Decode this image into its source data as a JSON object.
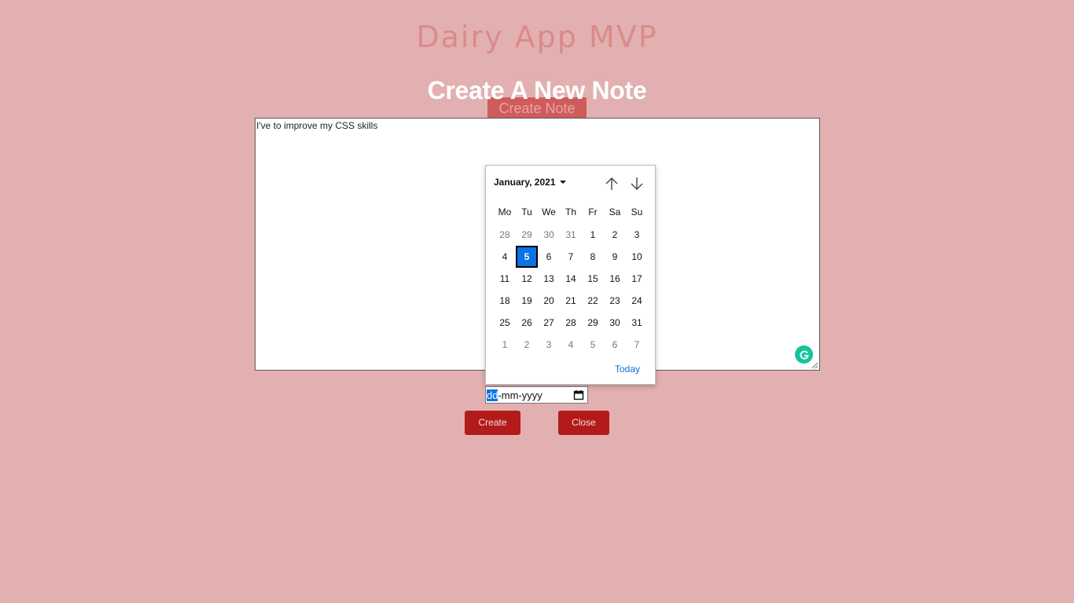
{
  "app": {
    "title": "Dairy App MVP",
    "create_note_label": "Create Note"
  },
  "modal": {
    "title": "Create A New Note",
    "note_text": "I've to improve my CSS skills",
    "date_input": {
      "day_placeholder": "dd",
      "rest_placeholder": "-mm-yyyy"
    },
    "create_label": "Create",
    "close_label": "Close"
  },
  "calendar": {
    "month_label": "January, 2021",
    "weekdays": [
      "Mo",
      "Tu",
      "We",
      "Th",
      "Fr",
      "Sa",
      "Su"
    ],
    "weeks": [
      [
        "28",
        "29",
        "30",
        "31",
        "1",
        "2",
        "3"
      ],
      [
        "4",
        "5",
        "6",
        "7",
        "8",
        "9",
        "10"
      ],
      [
        "11",
        "12",
        "13",
        "14",
        "15",
        "16",
        "17"
      ],
      [
        "18",
        "19",
        "20",
        "21",
        "22",
        "23",
        "24"
      ],
      [
        "25",
        "26",
        "27",
        "28",
        "29",
        "30",
        "31"
      ],
      [
        "1",
        "2",
        "3",
        "4",
        "5",
        "6",
        "7"
      ]
    ],
    "selected_day": "5",
    "today_label": "Today"
  },
  "colors": {
    "background": "#e2b0b0",
    "button": "#b31b1b",
    "selected_day": "#0a74e5",
    "grammarly": "#15c39a"
  },
  "icons": {
    "nav_up": "arrow-up-icon",
    "nav_down": "arrow-down-icon",
    "calendar": "calendar-icon",
    "grammarly": "grammarly-icon"
  }
}
